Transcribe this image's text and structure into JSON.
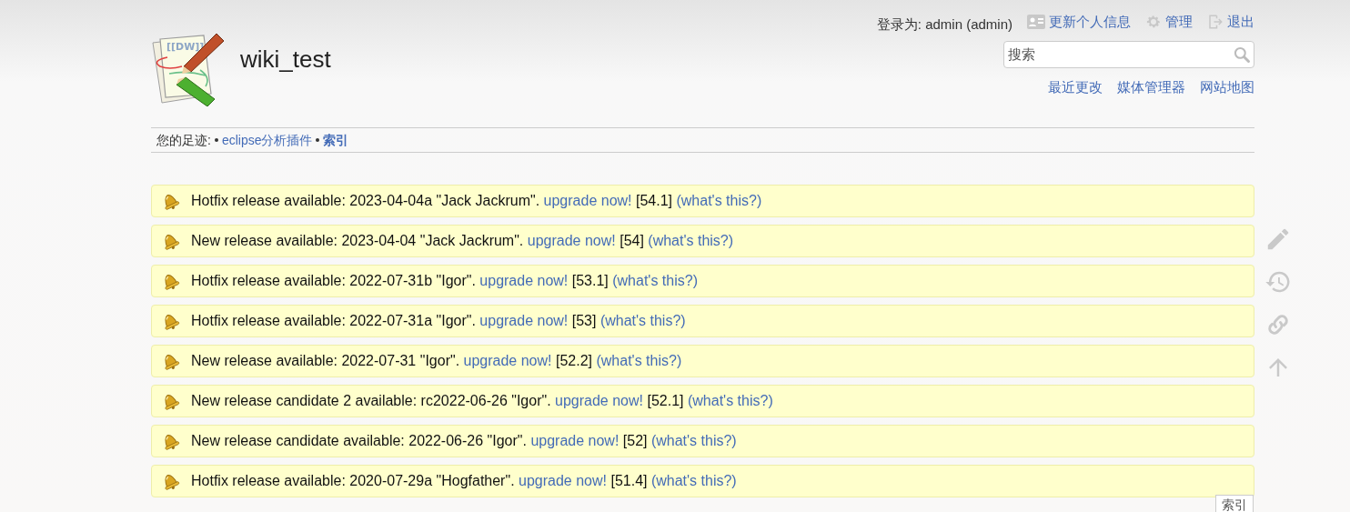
{
  "site": {
    "title": "wiki_test",
    "logo_text": "[[DW]]"
  },
  "user_bar": {
    "logged_in_as": "登录为: admin (admin)",
    "actions": [
      {
        "kind": "profile",
        "label": "更新个人信息"
      },
      {
        "kind": "admin",
        "label": "管理"
      },
      {
        "kind": "logout",
        "label": "退出"
      }
    ]
  },
  "search": {
    "placeholder": "搜索"
  },
  "site_tools": [
    "最近更改",
    "媒体管理器",
    "网站地图"
  ],
  "breadcrumbs": {
    "label": "您的足迹:",
    "items": [
      {
        "label": "eclipse分析插件",
        "current": false
      },
      {
        "label": "索引",
        "current": true
      }
    ]
  },
  "notices": [
    {
      "message": "Hotfix release available: 2023-04-04a \"Jack Jackrum\".",
      "link": "upgrade now!",
      "version": "[54.1]",
      "help": "(what's this?)"
    },
    {
      "message": "New release available: 2023-04-04 \"Jack Jackrum\".",
      "link": "upgrade now!",
      "version": "[54]",
      "help": "(what's this?)"
    },
    {
      "message": "Hotfix release available: 2022-07-31b \"Igor\".",
      "link": "upgrade now!",
      "version": "[53.1]",
      "help": "(what's this?)"
    },
    {
      "message": "Hotfix release available: 2022-07-31a \"Igor\".",
      "link": "upgrade now!",
      "version": "[53]",
      "help": "(what's this?)"
    },
    {
      "message": "New release available: 2022-07-31 \"Igor\".",
      "link": "upgrade now!",
      "version": "[52.2]",
      "help": "(what's this?)"
    },
    {
      "message": "New release candidate 2 available: rc2022-06-26 \"Igor\".",
      "link": "upgrade now!",
      "version": "[52.1]",
      "help": "(what's this?)"
    },
    {
      "message": "New release candidate available: 2022-06-26 \"Igor\".",
      "link": "upgrade now!",
      "version": "[52]",
      "help": "(what's this?)"
    },
    {
      "message": "Hotfix release available: 2020-07-29a \"Hogfather\".",
      "link": "upgrade now!",
      "version": "[51.4]",
      "help": "(what's this?)"
    }
  ],
  "page_tools": [
    {
      "kind": "edit"
    },
    {
      "kind": "revisions"
    },
    {
      "kind": "backlinks"
    },
    {
      "kind": "top"
    }
  ],
  "tooltip": "索引"
}
